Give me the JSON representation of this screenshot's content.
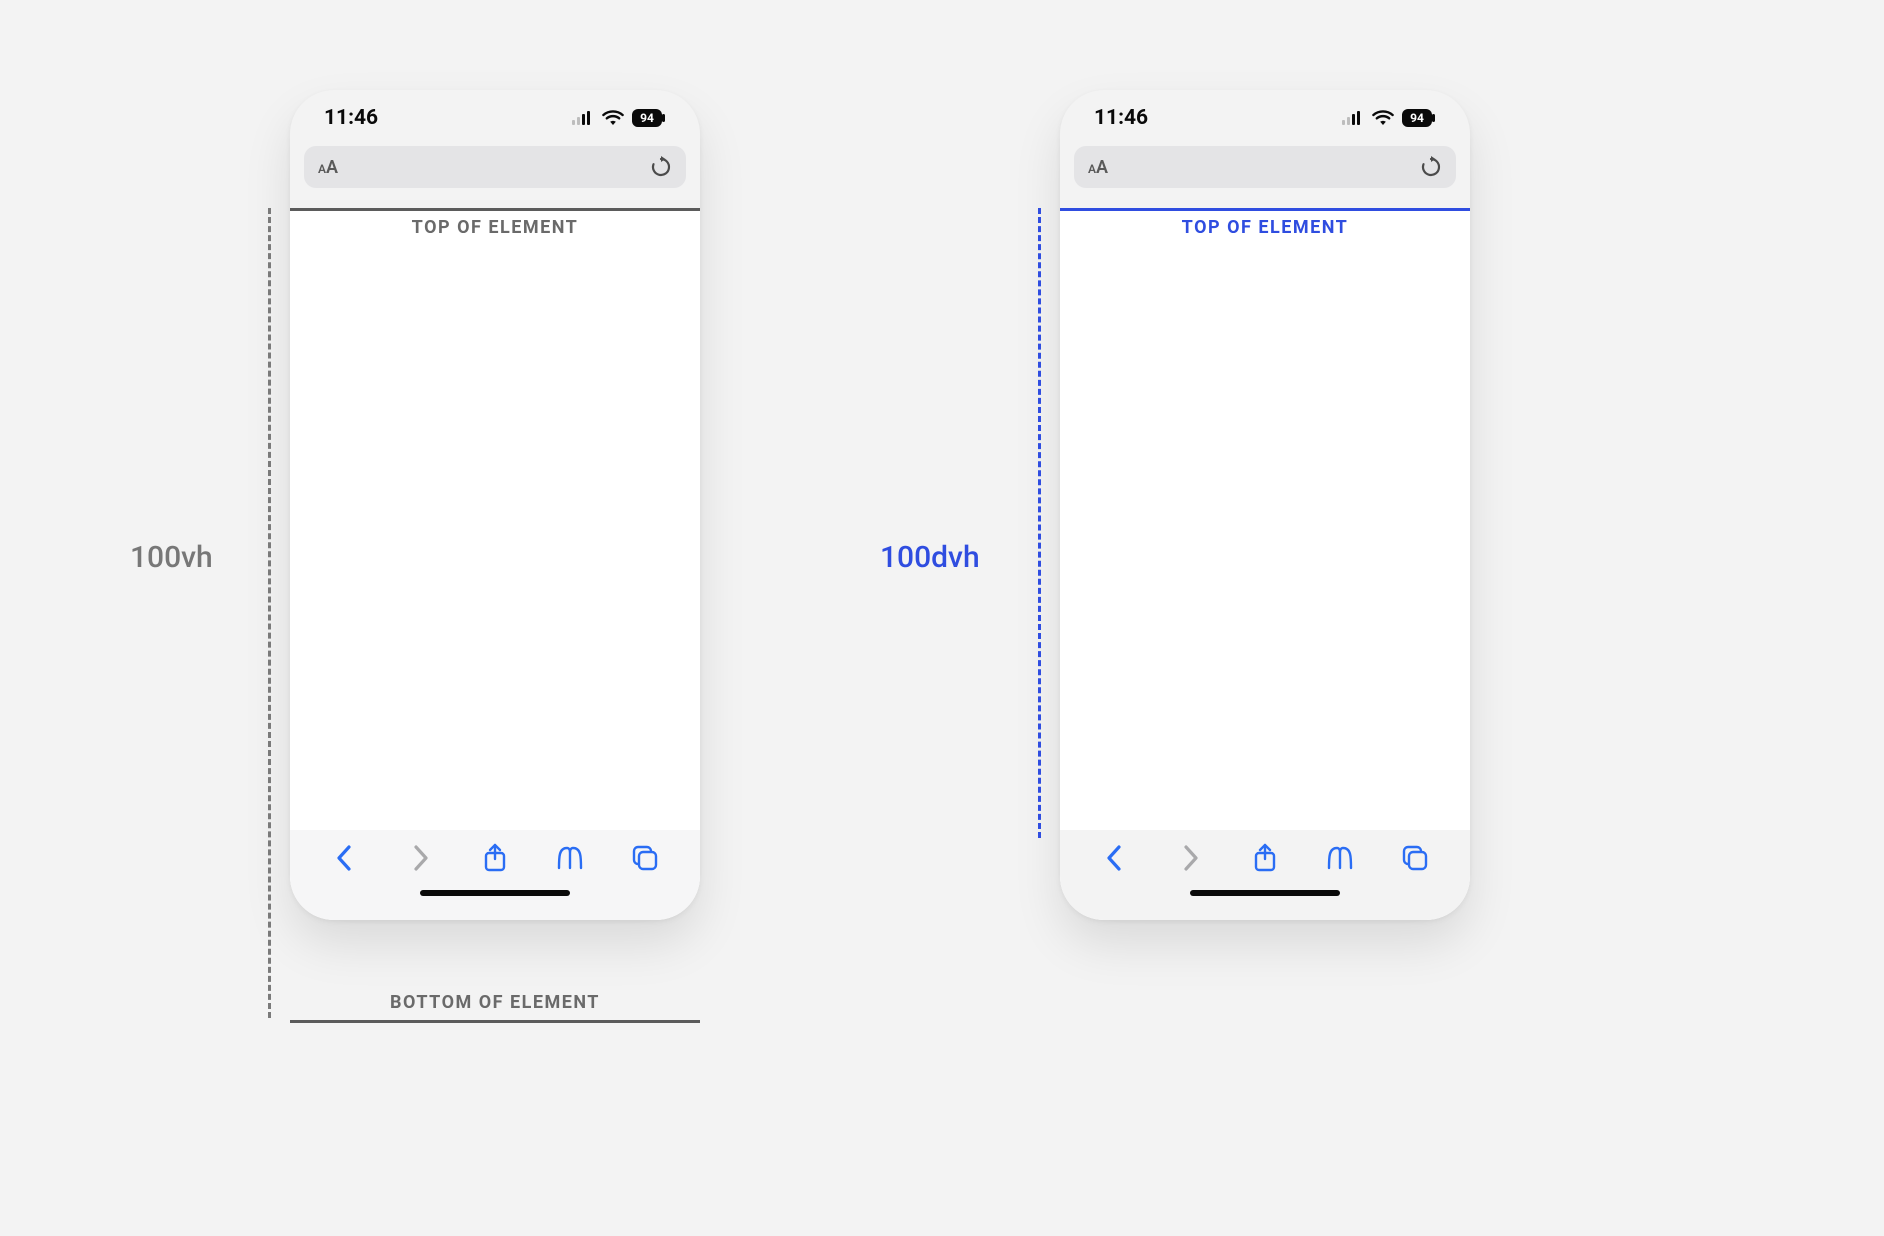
{
  "labels": {
    "left_unit": "100vh",
    "right_unit": "100dvh",
    "top_of_element": "TOP OF ELEMENT",
    "bottom_of_element": "BOTTOM OF ELEMENT"
  },
  "status": {
    "time": "11:46",
    "battery": "94"
  },
  "colors": {
    "muted": "#6a6a6a",
    "blue": "#2f4de0",
    "ios_blue": "#2a6df4",
    "toolbar_inactive": "#a9a9ab"
  },
  "urlbar": {
    "reader_text": "A"
  }
}
